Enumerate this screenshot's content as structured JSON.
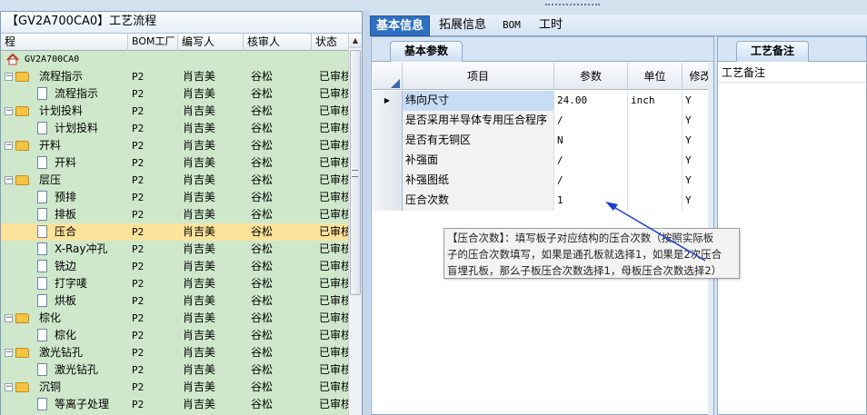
{
  "left_panel": {
    "title": "【GV2A700CA0】工艺流程",
    "columns": [
      "程",
      "BOM工厂",
      "编写人",
      "核审人",
      "状态"
    ],
    "root_label": "GV2A700CA0",
    "rows": [
      {
        "name": "流程指示",
        "type": "folder",
        "level": 1,
        "bom": "P2",
        "writer": "肖吉美",
        "reviewer": "谷松",
        "status": "已审核"
      },
      {
        "name": "流程指示",
        "type": "doc",
        "level": 2,
        "bom": "P2",
        "writer": "肖吉美",
        "reviewer": "谷松",
        "status": "已审核"
      },
      {
        "name": "计划投料",
        "type": "folder",
        "level": 1,
        "bom": "P2",
        "writer": "肖吉美",
        "reviewer": "谷松",
        "status": "已审核"
      },
      {
        "name": "计划投料",
        "type": "doc",
        "level": 2,
        "bom": "P2",
        "writer": "肖吉美",
        "reviewer": "谷松",
        "status": "已审核"
      },
      {
        "name": "开料",
        "type": "folder",
        "level": 1,
        "bom": "P2",
        "writer": "肖吉美",
        "reviewer": "谷松",
        "status": "已审核"
      },
      {
        "name": "开料",
        "type": "doc",
        "level": 2,
        "bom": "P2",
        "writer": "肖吉美",
        "reviewer": "谷松",
        "status": "已审核"
      },
      {
        "name": "层压",
        "type": "folder",
        "level": 1,
        "bom": "P2",
        "writer": "肖吉美",
        "reviewer": "谷松",
        "status": "已审核"
      },
      {
        "name": "预排",
        "type": "doc",
        "level": 2,
        "bom": "P2",
        "writer": "肖吉美",
        "reviewer": "谷松",
        "status": "已审核"
      },
      {
        "name": "排板",
        "type": "doc",
        "level": 2,
        "bom": "P2",
        "writer": "肖吉美",
        "reviewer": "谷松",
        "status": "已审核"
      },
      {
        "name": "压合",
        "type": "doc",
        "level": 2,
        "bom": "P2",
        "writer": "肖吉美",
        "reviewer": "谷松",
        "status": "已审核",
        "selected": true
      },
      {
        "name": "X-Ray冲孔",
        "type": "doc",
        "level": 2,
        "bom": "P2",
        "writer": "肖吉美",
        "reviewer": "谷松",
        "status": "已审核"
      },
      {
        "name": "铣边",
        "type": "doc",
        "level": 2,
        "bom": "P2",
        "writer": "肖吉美",
        "reviewer": "谷松",
        "status": "已审核"
      },
      {
        "name": "打字唛",
        "type": "doc",
        "level": 2,
        "bom": "P2",
        "writer": "肖吉美",
        "reviewer": "谷松",
        "status": "已审核"
      },
      {
        "name": "烘板",
        "type": "doc",
        "level": 2,
        "bom": "P2",
        "writer": "肖吉美",
        "reviewer": "谷松",
        "status": "已审核"
      },
      {
        "name": "棕化",
        "type": "folder",
        "level": 1,
        "bom": "P2",
        "writer": "肖吉美",
        "reviewer": "谷松",
        "status": "已审核"
      },
      {
        "name": "棕化",
        "type": "doc",
        "level": 2,
        "bom": "P2",
        "writer": "肖吉美",
        "reviewer": "谷松",
        "status": "已审核"
      },
      {
        "name": "激光钻孔",
        "type": "folder",
        "level": 1,
        "bom": "P2",
        "writer": "肖吉美",
        "reviewer": "谷松",
        "status": "已审核"
      },
      {
        "name": "激光钻孔",
        "type": "doc",
        "level": 2,
        "bom": "P2",
        "writer": "肖吉美",
        "reviewer": "谷松",
        "status": "已审核"
      },
      {
        "name": "沉铜",
        "type": "folder",
        "level": 1,
        "bom": "P2",
        "writer": "肖吉美",
        "reviewer": "谷松",
        "status": "已审核"
      },
      {
        "name": "等离子处理",
        "type": "doc",
        "level": 2,
        "bom": "P2",
        "writer": "肖吉美",
        "reviewer": "谷松",
        "status": "已审核"
      }
    ]
  },
  "tabs": [
    {
      "label": "基本信息",
      "active": true
    },
    {
      "label": "拓展信息",
      "active": false
    },
    {
      "label": "BOM",
      "active": false
    },
    {
      "label": "工时",
      "active": false
    }
  ],
  "params_panel": {
    "tab_label": "基本参数",
    "columns": [
      "项目",
      "参数",
      "单位",
      "修改"
    ],
    "rows": [
      {
        "item": "纬向尺寸",
        "value": "24.00",
        "unit": "inch",
        "mod": "Y",
        "current": true
      },
      {
        "item": "是否采用半导体专用压合程序",
        "value": "/",
        "unit": "",
        "mod": "Y"
      },
      {
        "item": "是否有无铜区",
        "value": "N",
        "unit": "",
        "mod": "Y"
      },
      {
        "item": "补强面",
        "value": "/",
        "unit": "",
        "mod": "Y"
      },
      {
        "item": "补强图纸",
        "value": "/",
        "unit": "",
        "mod": "Y"
      },
      {
        "item": "压合次数",
        "value": "1",
        "unit": "",
        "mod": "Y"
      }
    ]
  },
  "notes_panel": {
    "tab_label": "工艺备注",
    "column": "工艺备注"
  },
  "tooltip": {
    "lines": [
      "【压合次数】：填写板子对应结构的压合次数（按照实际板",
      "子的压合次数填写，如果是通孔板就选择1，如果是2次压合",
      "盲埋孔板，那么子板压合次数选择1，母板压合次数选择2）"
    ]
  },
  "colors": {
    "tree_bg": "#cfe8cc",
    "selected_row": "#fde39a",
    "active_tab": "#2f6fc1",
    "arrow": "#1f3fd0"
  }
}
